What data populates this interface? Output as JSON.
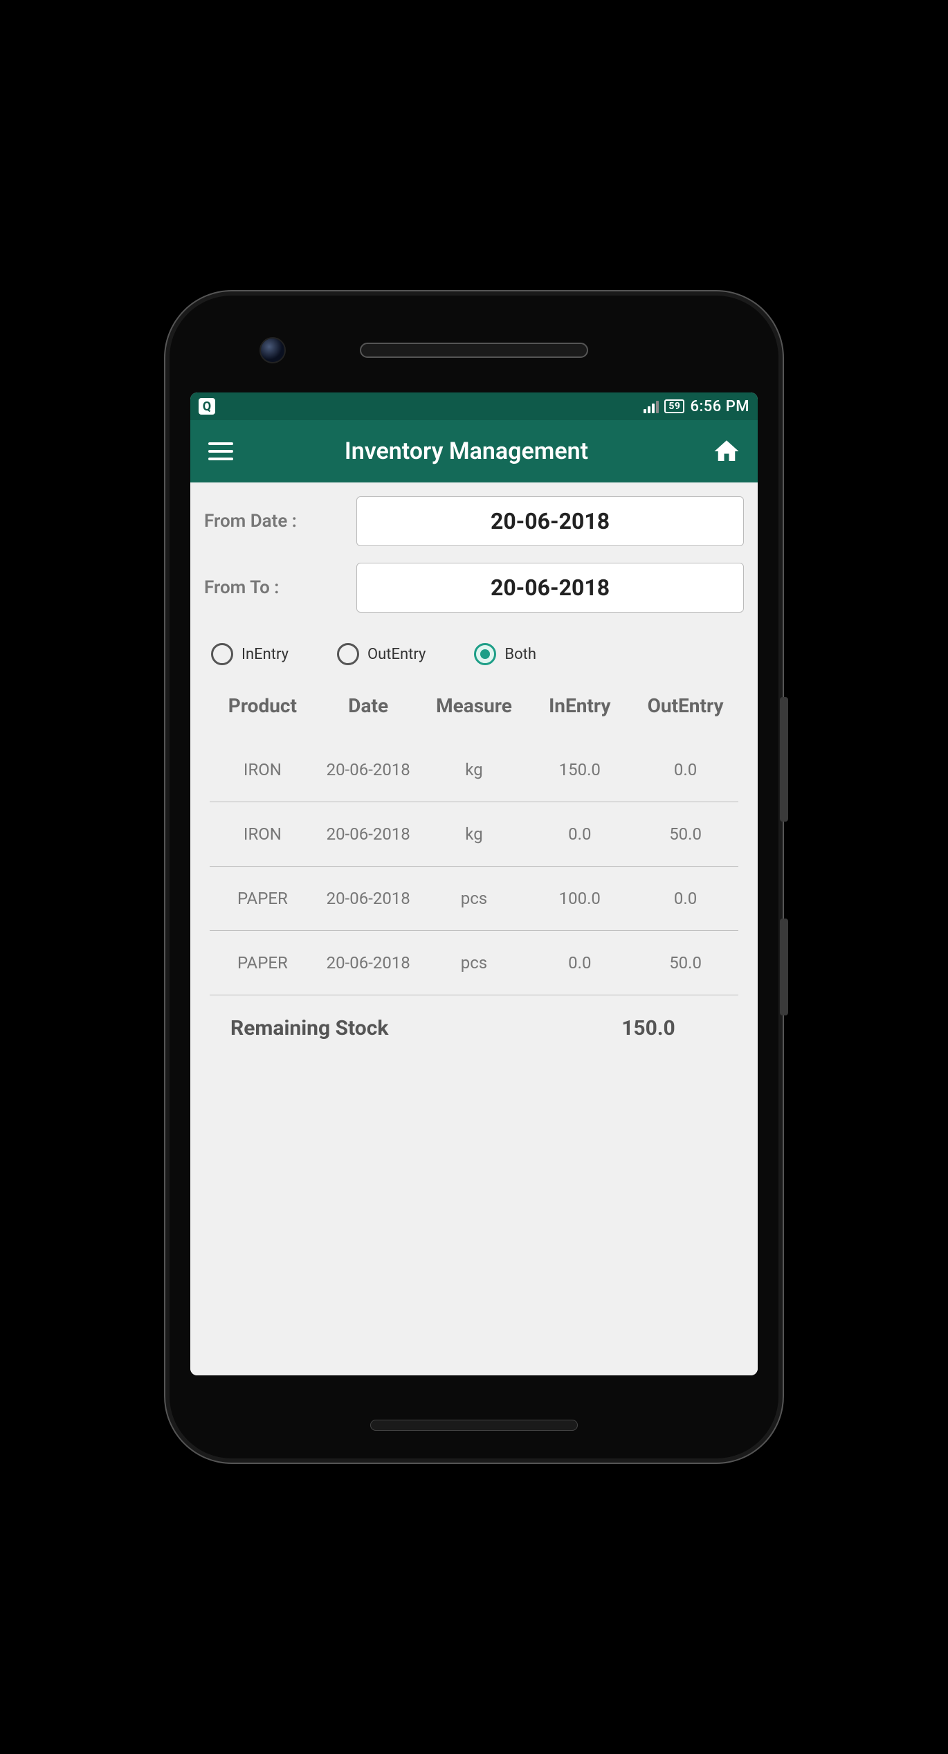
{
  "status_bar": {
    "battery_level": "59",
    "time": "6:56 PM"
  },
  "app_bar": {
    "title": "Inventory Management"
  },
  "filters": {
    "from_date_label": "From Date :",
    "from_date_value": "20-06-2018",
    "to_date_label": "From To :",
    "to_date_value": "20-06-2018",
    "radio_options": {
      "in": "InEntry",
      "out": "OutEntry",
      "both": "Both"
    },
    "selected": "both"
  },
  "table": {
    "headers": {
      "product": "Product",
      "date": "Date",
      "measure": "Measure",
      "in": "InEntry",
      "out": "OutEntry"
    },
    "rows": [
      {
        "product": "IRON",
        "date": "20-06-2018",
        "measure": "kg",
        "in": "150.0",
        "out": "0.0"
      },
      {
        "product": "IRON",
        "date": "20-06-2018",
        "measure": "kg",
        "in": "0.0",
        "out": "50.0"
      },
      {
        "product": "PAPER",
        "date": "20-06-2018",
        "measure": "pcs",
        "in": "100.0",
        "out": "0.0"
      },
      {
        "product": "PAPER",
        "date": "20-06-2018",
        "measure": "pcs",
        "in": "0.0",
        "out": "50.0"
      }
    ]
  },
  "summary": {
    "label": "Remaining Stock",
    "value": "150.0"
  }
}
